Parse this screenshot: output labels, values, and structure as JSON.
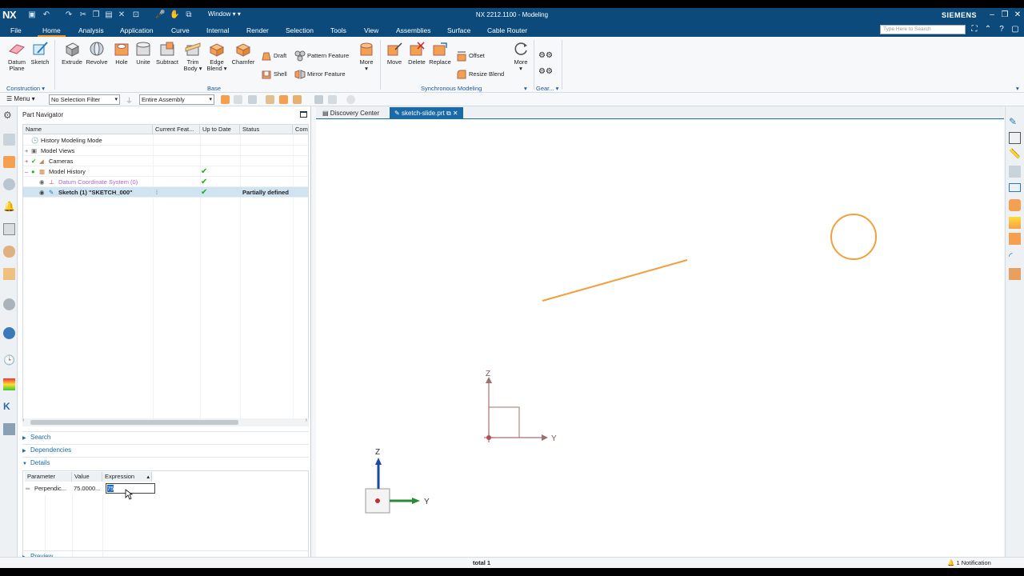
{
  "titlebar": {
    "logo": "NX",
    "window_menu": "Window",
    "app_title": "NX 2212.1100 - Modeling",
    "brand": "SIEMENS"
  },
  "tabs": [
    "File",
    "Home",
    "Analysis",
    "Application",
    "Curve",
    "Internal",
    "Render",
    "Selection",
    "Tools",
    "View",
    "Assemblies",
    "Surface",
    "Cable Router"
  ],
  "search_placeholder": "Type Here to Search",
  "ribbon": {
    "datum_plane": "Datum Plane",
    "sketch": "Sketch",
    "extrude": "Extrude",
    "revolve": "Revolve",
    "hole": "Hole",
    "unite": "Unite",
    "subtract": "Subtract",
    "trim_body": "Trim Body",
    "edge_blend": "Edge Blend",
    "chamfer": "Chamfer",
    "draft": "Draft",
    "shell": "Shell",
    "pattern_feature": "Pattern Feature",
    "mirror_feature": "Mirror Feature",
    "more": "More",
    "move": "Move",
    "delete": "Delete",
    "replace": "Replace",
    "offset": "Offset",
    "resize_blend": "Resize Blend",
    "more2": "More",
    "group_construction": "Construction",
    "group_base": "Base",
    "group_sync": "Synchronous Modeling",
    "group_gear": "Gear..."
  },
  "filterbar": {
    "menu": "Menu",
    "selection_filter": "No Selection Filter",
    "scope": "Entire Assembly"
  },
  "navigator": {
    "title": "Part Navigator",
    "columns": [
      "Name",
      "Current Feat...",
      "Up to Date",
      "Status",
      "Comm"
    ],
    "rows": [
      {
        "name": "History Modeling Mode",
        "uptodate": "",
        "status": ""
      },
      {
        "name": "Model Views",
        "uptodate": "",
        "status": ""
      },
      {
        "name": "Cameras",
        "uptodate": "",
        "status": ""
      },
      {
        "name": "Model History",
        "uptodate": "",
        "status": ""
      },
      {
        "name": "Datum Coordinate System (0)",
        "uptodate": "",
        "status": ""
      },
      {
        "name": "Sketch (1) \"SKETCH_000\"",
        "uptodate": "",
        "status": "Partially defined"
      }
    ],
    "sections": {
      "search": "Search",
      "dependencies": "Dependencies",
      "details": "Details",
      "preview": "Preview"
    },
    "details": {
      "columns": [
        "Parameter",
        "Value",
        "Expression"
      ],
      "param": "Perpendic...",
      "value": "75.0000...",
      "expression": "75"
    }
  },
  "graphics_tabs": [
    "Discovery Center",
    "sketch-slide.prt"
  ],
  "axes": {
    "z": "Z",
    "y": "Y"
  },
  "status": {
    "total": "total 1",
    "notification": "1 Notification"
  },
  "colors": {
    "titlebar": "#0b4a7a",
    "accent": "#f08c1a",
    "sketch_curve": "#f0a040",
    "select": "#1a6aa8"
  }
}
